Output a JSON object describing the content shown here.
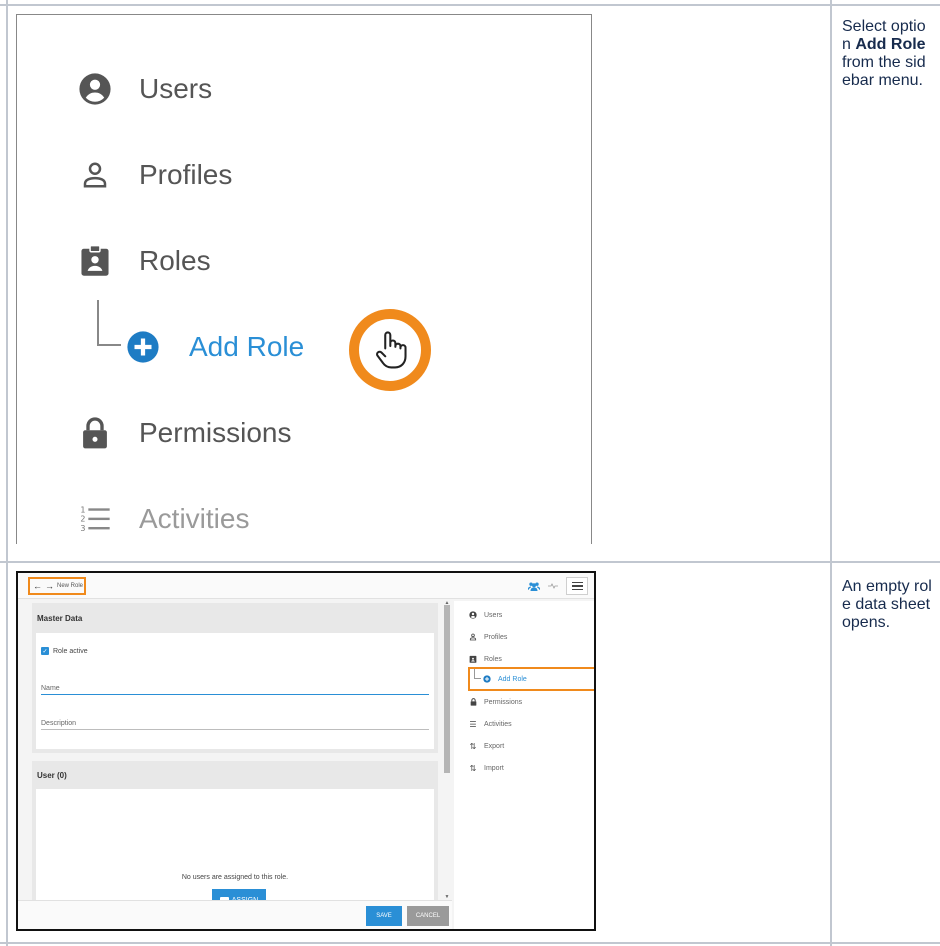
{
  "steps": [
    {
      "instruction": {
        "prefix": "Select option ",
        "bold": "Add Role",
        "suffix": " from the sidebar menu."
      },
      "zoomed_menu": {
        "items": [
          {
            "label": "Users",
            "icon": "account-circle-icon"
          },
          {
            "label": "Profiles",
            "icon": "person-outline-icon"
          },
          {
            "label": "Roles",
            "icon": "badge-icon"
          },
          {
            "label": "Add Role",
            "icon": "plus-circle-icon",
            "highlighted": true
          },
          {
            "label": "Permissions",
            "icon": "lock-icon"
          },
          {
            "label": "Activities",
            "icon": "numbered-list-icon"
          }
        ],
        "cursor": "hand-pointer-icon"
      }
    },
    {
      "instruction": {
        "text": "An empty role data sheet opens."
      },
      "app": {
        "breadcrumb_title": "New Role",
        "master_data": {
          "title": "Master Data",
          "role_active_label": "Role active",
          "role_active_checked": true,
          "name_placeholder": "Name",
          "description_placeholder": "Description"
        },
        "users_section": {
          "title": "User (0)",
          "empty_message": "No users are assigned to this role.",
          "assign_label": "ASSIGN"
        },
        "save_label": "SAVE",
        "cancel_label": "CANCEL",
        "sidebar": [
          {
            "label": "Users",
            "icon": "account-circle-icon"
          },
          {
            "label": "Profiles",
            "icon": "person-outline-icon"
          },
          {
            "label": "Roles",
            "icon": "badge-icon"
          },
          {
            "label": "Add Role",
            "icon": "plus-circle-icon",
            "highlighted": true
          },
          {
            "label": "Permissions",
            "icon": "lock-icon"
          },
          {
            "label": "Activities",
            "icon": "list-icon"
          },
          {
            "label": "Export",
            "icon": "sort-arrows-icon"
          },
          {
            "label": "Import",
            "icon": "sort-arrows-icon"
          }
        ]
      }
    }
  ],
  "colors": {
    "accent": "#2a8fd6",
    "highlight": "#f08a1c"
  }
}
